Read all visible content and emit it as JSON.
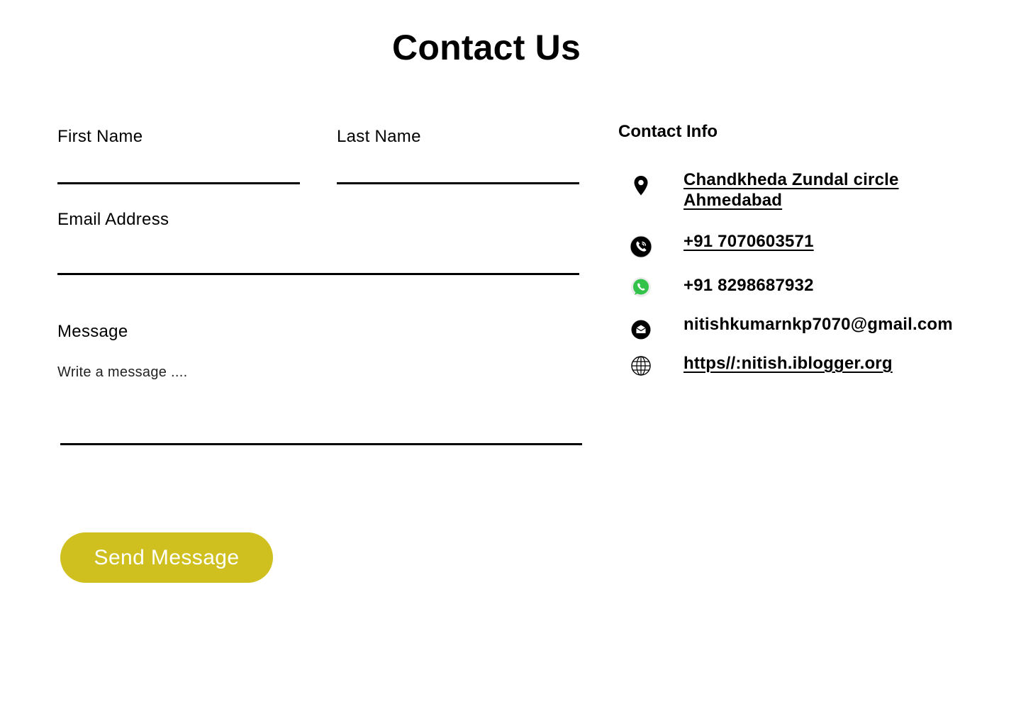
{
  "page": {
    "title": "Contact Us"
  },
  "form": {
    "first_name_label": "First Name",
    "last_name_label": "Last Name",
    "email_label": "Email Address",
    "message_label": "Message",
    "message_placeholder": "Write a message ....",
    "submit_label": "Send Message"
  },
  "contact_info": {
    "heading": "Contact Info",
    "address_line1": "Chandkheda Zundal circle",
    "address_line2": "Ahmedabad",
    "phone": "+91 7070603571",
    "whatsapp": "+91 8298687932",
    "email": "nitishkumarnkp7070@gmail.com",
    "website": "https//:nitish.iblogger.org"
  },
  "colors": {
    "accent": "#cfc020",
    "text": "#000000",
    "background": "#ffffff",
    "whatsapp": "#33c24a"
  },
  "icons": {
    "address": "map-pin-icon",
    "phone": "phone-icon",
    "whatsapp": "whatsapp-icon",
    "email": "envelope-icon",
    "website": "globe-icon"
  }
}
